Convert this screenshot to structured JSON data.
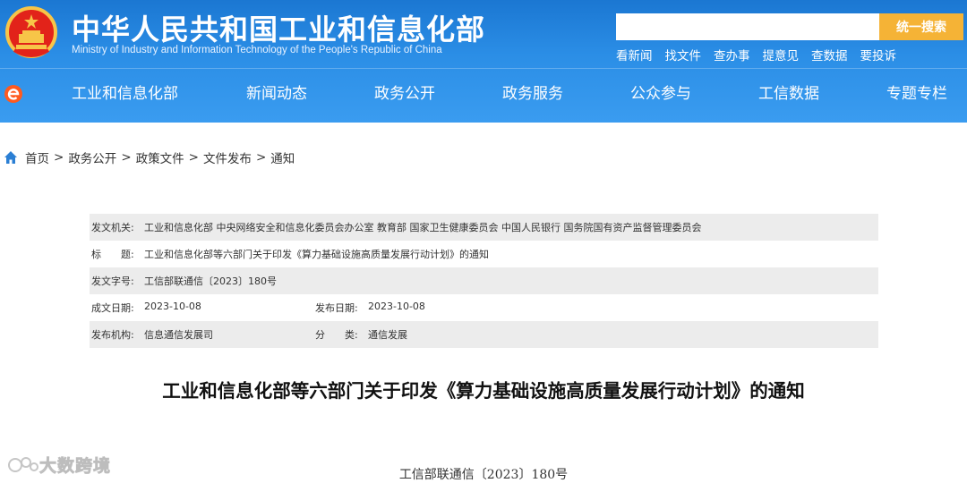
{
  "header": {
    "title": "中华人民共和国工业和信息化部",
    "subtitle": "Ministry of Industry and Information Technology of the People's Republic of China",
    "emblem_icon": "national-emblem-icon",
    "search": {
      "placeholder": "",
      "button_label": "统一搜索"
    },
    "quick_links": [
      "看新闻",
      "找文件",
      "查办事",
      "提意见",
      "查数据",
      "要投诉"
    ]
  },
  "nav": {
    "items": [
      "工业和信息化部",
      "新闻动态",
      "政务公开",
      "政务服务",
      "公众参与",
      "工信数据",
      "专题专栏"
    ]
  },
  "breadcrumb": {
    "home_icon": "home-icon",
    "items": [
      "首页",
      "政务公开",
      "政策文件",
      "文件发布",
      "通知"
    ],
    "separator": ">"
  },
  "meta": {
    "issuer_label": "发文机关:",
    "issuer_value": "工业和信息化部 中央网络安全和信息化委员会办公室 教育部 国家卫生健康委员会 中国人民银行 国务院国有资产监督管理委员会",
    "title_label": "标　　题:",
    "title_value": "工业和信息化部等六部门关于印发《算力基础设施高质量发展行动计划》的通知",
    "docno_label": "发文字号:",
    "docno_value": "工信部联通信〔2023〕180号",
    "created_label": "成文日期:",
    "created_value": "2023-10-08",
    "published_label": "发布日期:",
    "published_value": "2023-10-08",
    "agency_label": "发布机构:",
    "agency_value": "信息通信发展司",
    "category_label": "分　　类:",
    "category_value": "通信发展"
  },
  "document": {
    "title": "工业和信息化部等六部门关于印发《算力基础设施高质量发展行动计划》的通知",
    "number": "工信部联通信〔2023〕180号"
  },
  "watermark": {
    "text": "大数跨境"
  },
  "colors": {
    "header_blue": "#2b8ee6",
    "search_button": "#f5b336",
    "meta_shade": "#ececec"
  }
}
